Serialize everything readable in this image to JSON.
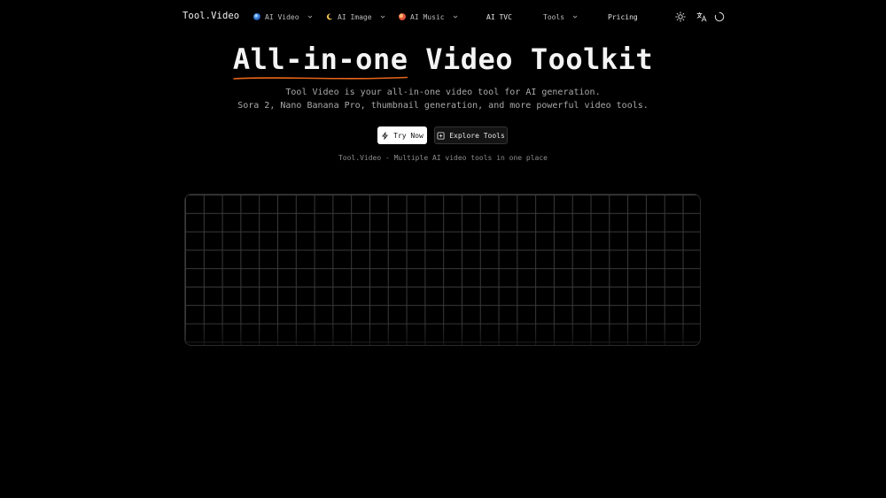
{
  "nav": {
    "logo": "Tool.Video",
    "items": [
      {
        "label": "AI Video",
        "icon": "crystal-ball-icon",
        "has_dropdown": true
      },
      {
        "label": "AI Image",
        "icon": "crescent-moon-icon",
        "has_dropdown": true
      },
      {
        "label": "AI Music",
        "icon": "orange-planet-icon",
        "has_dropdown": true
      },
      {
        "label": "AI TVC",
        "has_dropdown": false
      },
      {
        "label": "Tools",
        "has_dropdown": true
      },
      {
        "label": "Pricing",
        "has_dropdown": false
      }
    ],
    "icons": [
      "sun-icon",
      "translate-icon",
      "loading-spinner-icon"
    ]
  },
  "hero": {
    "title_highlight": "All-in-one",
    "title_rest": " Video Toolkit",
    "subtitle_line1": "Tool Video is your all-in-one video tool for AI generation.",
    "subtitle_line2": "Sora 2, Nano Banana Pro, thumbnail generation, and more powerful video tools.",
    "primary_button": "Try Now",
    "secondary_button": "Explore Tools",
    "tagline": "Tool.Video - Multiple AI video tools in one place"
  },
  "colors": {
    "background": "#000000",
    "accent_underline": "#e8651a",
    "primary_button_bg": "#ffffff",
    "grid_line": "#3a3a3a"
  }
}
